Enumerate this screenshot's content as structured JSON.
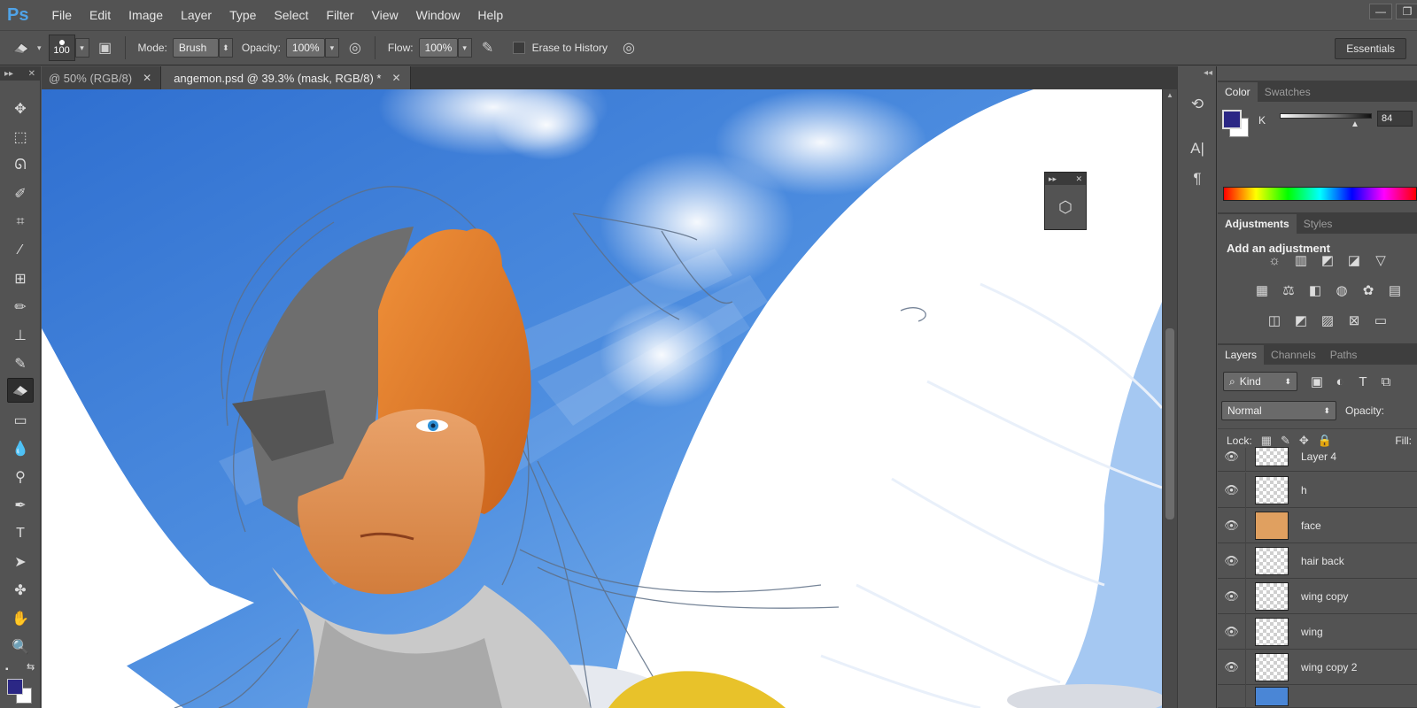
{
  "app": {
    "logo": "Ps"
  },
  "menu": [
    "File",
    "Edit",
    "Image",
    "Layer",
    "Type",
    "Select",
    "Filter",
    "View",
    "Window",
    "Help"
  ],
  "window_controls": {
    "minimize": "—",
    "restore": "❐"
  },
  "options": {
    "brush_size": "100",
    "mode_label": "Mode:",
    "mode_value": "Brush",
    "opacity_label": "Opacity:",
    "opacity_value": "100%",
    "flow_label": "Flow:",
    "flow_value": "100%",
    "erase_history_label": "Erase to History",
    "workspace": "Essentials"
  },
  "doc_tabs": [
    {
      "title": "@ 50% (RGB/8)",
      "active": false
    },
    {
      "title": "angemon.psd @ 39.3% (mask, RGB/8) *",
      "active": true
    }
  ],
  "color_panel": {
    "tabs": [
      "Color",
      "Swatches"
    ],
    "active_tab": "Color",
    "channel_label": "K",
    "channel_value": "84",
    "foreground": "#2b2785",
    "background": "#ffffff"
  },
  "adjustments_panel": {
    "tabs": [
      "Adjustments",
      "Styles"
    ],
    "active_tab": "Adjustments",
    "heading": "Add an adjustment"
  },
  "layers_panel": {
    "tabs": [
      "Layers",
      "Channels",
      "Paths"
    ],
    "active_tab": "Layers",
    "filter": "Kind",
    "blend_mode": "Normal",
    "opacity_label": "Opacity:",
    "lock_label": "Lock:",
    "fill_label": "Fill:",
    "layers": [
      {
        "name": "Layer 4",
        "visible": true
      },
      {
        "name": "h",
        "visible": true
      },
      {
        "name": "face",
        "visible": true
      },
      {
        "name": "hair back",
        "visible": true
      },
      {
        "name": "wing copy",
        "visible": true
      },
      {
        "name": "wing",
        "visible": true
      },
      {
        "name": "wing copy 2",
        "visible": true
      }
    ]
  },
  "colors": {
    "panel_bg": "#535353",
    "panel_dark": "#3e3e3e",
    "ps_blue": "#4fa3e8",
    "sky_blue": "#4a86d6",
    "hair_orange": "#e07a24"
  }
}
